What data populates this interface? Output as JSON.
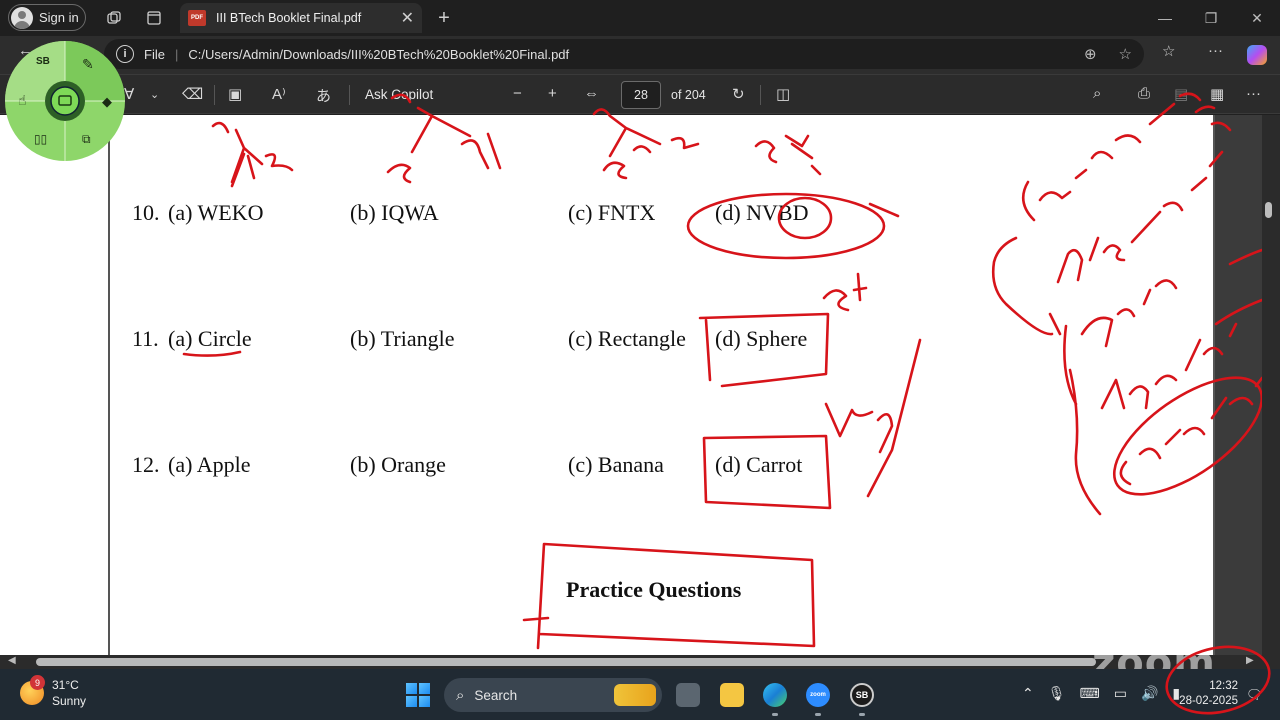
{
  "browser": {
    "sign_in": "Sign in",
    "tab_title": "III BTech Booklet Final.pdf",
    "pdf_badge": "PDF",
    "address_label": "File",
    "address_url": "C:/Users/Admin/Downloads/III%20BTech%20Booklet%20Final.pdf"
  },
  "pdf_toolbar": {
    "ask_copilot": "Ask Copilot",
    "page_number": "28",
    "page_total": "of 204"
  },
  "pen_menu": {
    "top_label": "SB"
  },
  "document": {
    "questions": [
      {
        "num": "10.",
        "a": "(a) WEKO",
        "b": "(b) IQWA",
        "c": "(c) FNTX",
        "d": "(d) NVBD"
      },
      {
        "num": "11.",
        "a": "(a) Circle",
        "b": "(b) Triangle",
        "c": "(c) Rectangle",
        "d": "(d) Sphere"
      },
      {
        "num": "12.",
        "a": "(a) Apple",
        "b": "(b) Orange",
        "c": "(c) Banana",
        "d": "(d) Carrot"
      }
    ],
    "section_heading": "Practice Questions"
  },
  "taskbar": {
    "weather_temp": "31°C",
    "weather_cond": "Sunny",
    "weather_badge": "9",
    "search_label": "Search",
    "zoom_app": "zoom",
    "sb_app": "SB",
    "time": "12:32",
    "date": "28-02-2025"
  },
  "watermark": "zoom",
  "colors": {
    "annotation": "#d7141a",
    "taskbar": "#202a33",
    "page": "#ffffff"
  }
}
